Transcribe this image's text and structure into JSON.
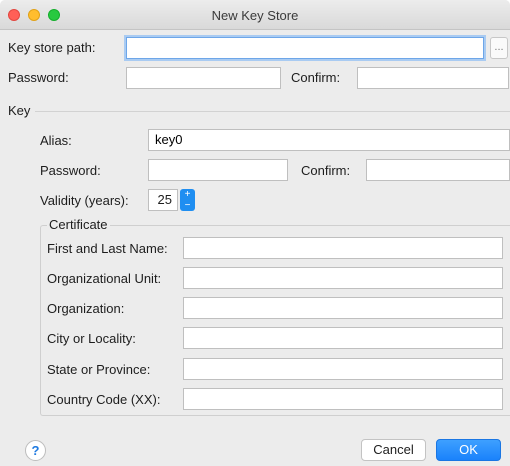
{
  "window": {
    "title": "New Key Store"
  },
  "keystore": {
    "path_label": "Key store path:",
    "path_value": "",
    "browse_label": "...",
    "password_label": "Password:",
    "password_value": "",
    "confirm_label": "Confirm:",
    "confirm_value": ""
  },
  "key": {
    "section_label": "Key",
    "alias_label": "Alias:",
    "alias_value": "key0",
    "password_label": "Password:",
    "password_value": "",
    "confirm_label": "Confirm:",
    "confirm_value": "",
    "validity_label": "Validity (years):",
    "validity_value": "25",
    "spinner_up": "+",
    "spinner_down": "−"
  },
  "certificate": {
    "group_label": "Certificate",
    "fields": [
      {
        "label": "First and Last Name:",
        "value": ""
      },
      {
        "label": "Organizational Unit:",
        "value": ""
      },
      {
        "label": "Organization:",
        "value": ""
      },
      {
        "label": "City or Locality:",
        "value": ""
      },
      {
        "label": "State or Province:",
        "value": ""
      },
      {
        "label": "Country Code (XX):",
        "value": ""
      }
    ]
  },
  "footer": {
    "help_label": "?",
    "cancel_label": "Cancel",
    "ok_label": "OK"
  },
  "colors": {
    "accent": "#1a82fb",
    "focus_ring": "#a9cbf2",
    "close": "#ff5f57",
    "minimize": "#ffbd2e",
    "zoom": "#28c940"
  }
}
